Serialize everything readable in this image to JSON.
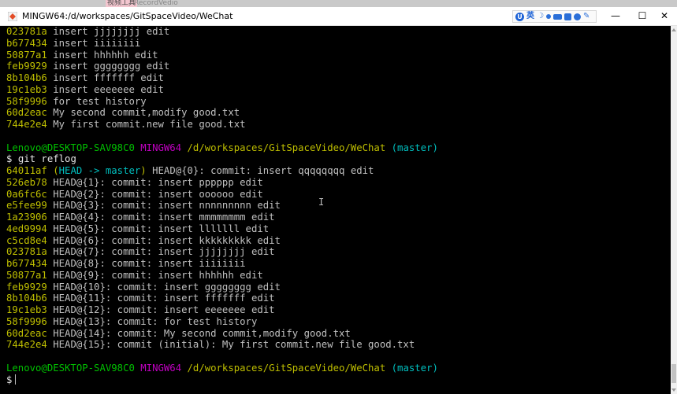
{
  "background_tabs": [
    "视频工具",
    "RecordVedio"
  ],
  "window": {
    "title": "MINGW64:/d/workspaces/GitSpaceVideo/WeChat",
    "controls": {
      "minimize": "—",
      "maximize": "☐",
      "close": "✕"
    }
  },
  "ime": {
    "logo_text": "U",
    "language": "英",
    "icons": [
      "moon-icon",
      "dot-icon",
      "keyboard-icon",
      "grid-icon",
      "user-icon",
      "wrench-icon"
    ]
  },
  "prompt": {
    "user_host": "Lenovo@DESKTOP-SAV98C0",
    "system": "MINGW64",
    "path": "/d/workspaces/GitSpaceVideo/WeChat",
    "branch": "(master)",
    "symbol": "$"
  },
  "log_tail": [
    {
      "hash": "023781a",
      "text": "insert jjjjjjjj edit"
    },
    {
      "hash": "b677434",
      "text": "insert iiiiiiii"
    },
    {
      "hash": "50877a1",
      "text": "insert hhhhhh edit"
    },
    {
      "hash": "feb9929",
      "text": "insert gggggggg edit"
    },
    {
      "hash": "8b104b6",
      "text": "insert fffffff edit"
    },
    {
      "hash": "19c1eb3",
      "text": "insert eeeeeee edit"
    },
    {
      "hash": "58f9996",
      "text": "for test history"
    },
    {
      "hash": "60d2eac",
      "text": "My second commit,modify good.txt"
    },
    {
      "hash": "744e2e4",
      "text": "My first commit.new file good.txt"
    }
  ],
  "command": "git reflog",
  "reflog_head": {
    "hash": "64011af",
    "ref_open": "(",
    "head_label": "HEAD -> master",
    "ref_close": ")",
    "text": "HEAD@{0}: commit: insert qqqqqqqq edit"
  },
  "reflog": [
    {
      "hash": "526eb78",
      "text": "HEAD@{1}: commit: insert pppppp edit"
    },
    {
      "hash": "0a6fc6c",
      "text": "HEAD@{2}: commit: insert oooooo edit"
    },
    {
      "hash": "e5fee99",
      "text": "HEAD@{3}: commit: insert nnnnnnnnn edit"
    },
    {
      "hash": "1a23906",
      "text": "HEAD@{4}: commit: insert mmmmmmmm edit"
    },
    {
      "hash": "4ed9994",
      "text": "HEAD@{5}: commit: insert lllllll edit"
    },
    {
      "hash": "c5cd8e4",
      "text": "HEAD@{6}: commit: insert kkkkkkkkk edit"
    },
    {
      "hash": "023781a",
      "text": "HEAD@{7}: commit: insert jjjjjjjj edit"
    },
    {
      "hash": "b677434",
      "text": "HEAD@{8}: commit: insert iiiiiiii"
    },
    {
      "hash": "50877a1",
      "text": "HEAD@{9}: commit: insert hhhhhh edit"
    },
    {
      "hash": "feb9929",
      "text": "HEAD@{10}: commit: insert gggggggg edit"
    },
    {
      "hash": "8b104b6",
      "text": "HEAD@{11}: commit: insert fffffff edit"
    },
    {
      "hash": "19c1eb3",
      "text": "HEAD@{12}: commit: insert eeeeeee edit"
    },
    {
      "hash": "58f9996",
      "text": "HEAD@{13}: commit: for test history"
    },
    {
      "hash": "60d2eac",
      "text": "HEAD@{14}: commit: My second commit,modify good.txt"
    },
    {
      "hash": "744e2e4",
      "text": "HEAD@{15}: commit (initial): My first commit.new file good.txt"
    }
  ],
  "colors": {
    "terminal_bg": "#000000",
    "hash": "#bfbf00",
    "prompt_user": "#00c000",
    "prompt_system": "#c000c0",
    "branch": "#00bfbf",
    "text": "#c0c0c0"
  }
}
